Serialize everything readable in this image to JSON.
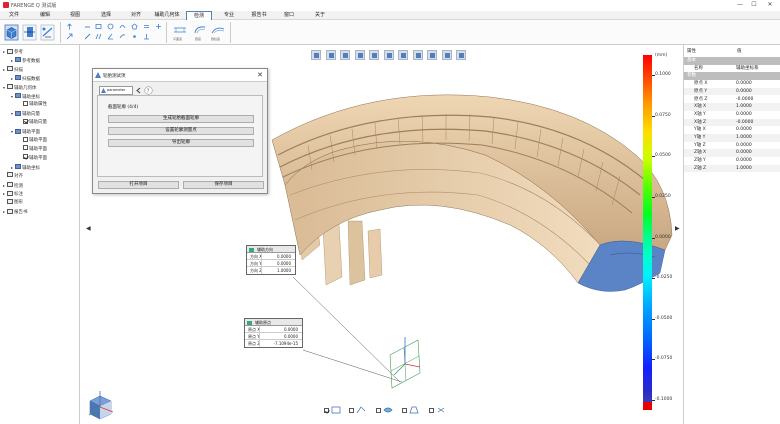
{
  "window": {
    "title": "FARENGE Q 测试版",
    "controls": [
      "—",
      "☐",
      "✕"
    ]
  },
  "menu": [
    {
      "label": "文件"
    },
    {
      "label": "编辑"
    },
    {
      "label": "视图"
    },
    {
      "label": "选择"
    },
    {
      "label": "对齐"
    },
    {
      "label": "辅助几何体"
    },
    {
      "label": "检测"
    },
    {
      "label": "专业"
    },
    {
      "label": "报告书"
    },
    {
      "label": "窗口"
    },
    {
      "label": "关于"
    }
  ],
  "ribbon": {
    "icon_labels": [
      "平面度",
      "圆度",
      "圆柱度"
    ]
  },
  "tree": {
    "items": [
      {
        "label": "参考",
        "arrow": "▸",
        "level": 0,
        "checkbox": false,
        "icon": "folder"
      },
      {
        "label": "参考数据",
        "arrow": "▸",
        "level": 1,
        "checkbox": false,
        "icon": "data"
      },
      {
        "label": "扫描",
        "arrow": "▸",
        "level": 0,
        "checkbox": false,
        "icon": "folder"
      },
      {
        "label": "扫描数据",
        "arrow": "▸",
        "level": 1,
        "checkbox": false,
        "icon": "data"
      },
      {
        "label": "辅助几何体",
        "arrow": "▾",
        "level": 0,
        "checkbox": false,
        "icon": "folder-open"
      },
      {
        "label": "辅助坐标",
        "arrow": "▾",
        "level": 1,
        "checkbox": false,
        "icon": "data"
      },
      {
        "label": "辅助属性",
        "arrow": "",
        "level": 2,
        "checkbox": true,
        "checked": false,
        "icon": ""
      },
      {
        "label": "辅助向量",
        "arrow": "▾",
        "level": 1,
        "checkbox": false,
        "icon": "data"
      },
      {
        "label": "辅助向量",
        "arrow": "",
        "level": 2,
        "checkbox": true,
        "checked": true,
        "icon": ""
      },
      {
        "label": "辅助平面",
        "arrow": "▾",
        "level": 1,
        "checkbox": false,
        "icon": "data"
      },
      {
        "label": "辅助平面",
        "arrow": "",
        "level": 2,
        "checkbox": true,
        "checked": false,
        "icon": ""
      },
      {
        "label": "辅助平面",
        "arrow": "",
        "level": 2,
        "checkbox": true,
        "checked": false,
        "icon": ""
      },
      {
        "label": "辅助平面",
        "arrow": "",
        "level": 2,
        "checkbox": true,
        "checked": true,
        "icon": ""
      },
      {
        "label": "辅助坐标",
        "arrow": "▸",
        "level": 1,
        "checkbox": false,
        "icon": "data"
      },
      {
        "label": "对齐",
        "arrow": "",
        "level": 0,
        "checkbox": false,
        "icon": "folder"
      },
      {
        "label": "检测",
        "arrow": "▸",
        "level": 0,
        "checkbox": false,
        "icon": "folder"
      },
      {
        "label": "标注",
        "arrow": "▸",
        "level": 0,
        "checkbox": false,
        "icon": "folder"
      },
      {
        "label": "图形",
        "arrow": "",
        "level": 0,
        "checkbox": false,
        "icon": "folder"
      },
      {
        "label": "报告书",
        "arrow": "▸",
        "level": 0,
        "checkbox": false,
        "icon": "folder"
      }
    ]
  },
  "dialog": {
    "title": "轮胎测试项",
    "close": "✕",
    "tab_label": "parameter",
    "stage": "截面轮廓 (4/4)",
    "buttons": [
      "生成轮胎截面轮廓",
      "设置轮廓测量点",
      "导出轮廓"
    ],
    "footer_buttons": [
      "打开项目",
      "保存项目"
    ]
  },
  "infobox_vector": {
    "header": "辅助方向",
    "rows": [
      {
        "k": "方向 X",
        "v": "0.0000"
      },
      {
        "k": "方向 Y",
        "v": "0.0000"
      },
      {
        "k": "方向 Z",
        "v": "1.0000"
      }
    ]
  },
  "infobox_point": {
    "header": "辅助原点",
    "rows": [
      {
        "k": "原点 X",
        "v": "0.0000"
      },
      {
        "k": "原点 Y",
        "v": "0.0000"
      },
      {
        "k": "原点 Z",
        "v": "-7.1094e-15"
      }
    ]
  },
  "colorbar": {
    "labels": [
      "(mm)",
      "0.1000",
      "0.0750",
      "0.0500",
      "0.0250",
      "0.0000",
      "-0.0250",
      "-0.0500",
      "-0.0750",
      "-0.1000"
    ]
  },
  "properties": {
    "header_key": "属性",
    "header_val": "值",
    "rows": [
      {
        "k": "基本",
        "v": "",
        "group": true
      },
      {
        "k": "名称",
        "v": "辅助坐标系"
      },
      {
        "k": "参数",
        "v": "",
        "group": true
      },
      {
        "k": "原点 X",
        "v": "0.0000"
      },
      {
        "k": "原点 Y",
        "v": "0.0000"
      },
      {
        "k": "原点 Z",
        "v": "-0.0000"
      },
      {
        "k": "X轴 X",
        "v": "1.0000"
      },
      {
        "k": "X轴 Y",
        "v": "0.0000"
      },
      {
        "k": "X轴 Z",
        "v": "-0.0000"
      },
      {
        "k": "Y轴 X",
        "v": "0.0000"
      },
      {
        "k": "Y轴 Y",
        "v": "1.0000"
      },
      {
        "k": "Y轴 Z",
        "v": "0.0000"
      },
      {
        "k": "Z轴 X",
        "v": "0.0000"
      },
      {
        "k": "Z轴 Y",
        "v": "0.0000"
      },
      {
        "k": "Z轴 Z",
        "v": "1.0000"
      }
    ]
  },
  "view_toolbar": {
    "icons": [
      "view-front-icon",
      "view-back-icon",
      "view-left-icon",
      "view-right-icon",
      "view-top-icon",
      "view-bottom-icon",
      "view-iso-icon",
      "fit-view-icon",
      "flip-view-icon",
      "rotate-left-icon",
      "rotate-right-icon"
    ]
  },
  "bottom_filters": [
    {
      "checked": true,
      "icon": "point-filter-icon"
    },
    {
      "checked": false,
      "icon": "edge-filter-icon"
    },
    {
      "checked": false,
      "icon": "surface-filter-icon"
    },
    {
      "checked": false,
      "icon": "mesh-filter-icon"
    },
    {
      "checked": false,
      "icon": "feature-filter-icon"
    }
  ]
}
